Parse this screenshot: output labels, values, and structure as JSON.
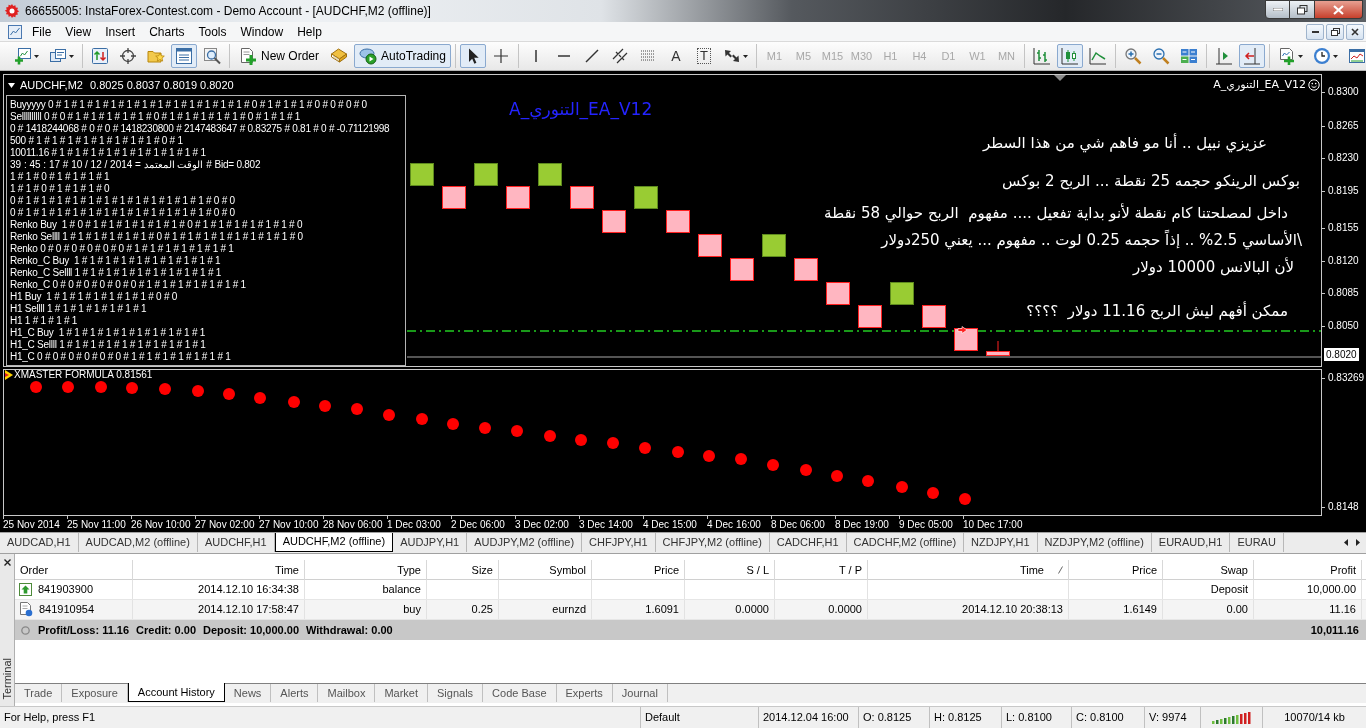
{
  "window": {
    "title": "66655005: InstaForex-Contest.com - Demo Account - [AUDCHF,M2 (offline)]"
  },
  "menu": [
    "File",
    "View",
    "Insert",
    "Charts",
    "Tools",
    "Window",
    "Help"
  ],
  "toolbar": [
    {
      "items": [
        {
          "kind": "icon",
          "pressed": false
        },
        {
          "kind": "icon",
          "pressed": false
        }
      ]
    },
    {
      "items": [
        {
          "kind": "icon",
          "pressed": false
        },
        {
          "kind": "icon",
          "pressed": false
        },
        {
          "kind": "icon",
          "pressed": false
        },
        {
          "kind": "icon",
          "pressed": true
        },
        {
          "kind": "icon",
          "pressed": false
        }
      ]
    },
    {
      "items": [
        {
          "kind": "button",
          "label": "New Order",
          "pressed": false
        },
        {
          "kind": "icon",
          "pressed": false
        },
        {
          "kind": "button",
          "label": "AutoTrading",
          "pressed": true
        }
      ]
    },
    {
      "items": [
        {
          "kind": "icon",
          "pressed": true
        },
        {
          "kind": "icon",
          "pressed": false
        }
      ]
    },
    {
      "items": [
        {
          "kind": "icon",
          "pressed": false
        },
        {
          "kind": "icon",
          "pressed": false
        },
        {
          "kind": "icon",
          "pressed": false
        },
        {
          "kind": "icon",
          "pressed": false
        },
        {
          "kind": "icon",
          "pressed": false
        },
        {
          "kind": "text",
          "label": "A",
          "pressed": false
        },
        {
          "kind": "framed",
          "label": "T",
          "pressed": false
        },
        {
          "kind": "icon",
          "pressed": false
        }
      ]
    },
    {
      "items": [
        {
          "kind": "timeframe",
          "label": "M1",
          "disabled": true
        },
        {
          "kind": "timeframe",
          "label": "M5",
          "disabled": true
        },
        {
          "kind": "timeframe",
          "label": "M15",
          "disabled": true
        },
        {
          "kind": "timeframe",
          "label": "M30",
          "disabled": true
        },
        {
          "kind": "timeframe",
          "label": "H1",
          "disabled": true
        },
        {
          "kind": "timeframe",
          "label": "H4",
          "disabled": true
        },
        {
          "kind": "timeframe",
          "label": "D1",
          "disabled": true
        },
        {
          "kind": "timeframe",
          "label": "W1",
          "disabled": true
        },
        {
          "kind": "timeframe",
          "label": "MN",
          "disabled": true
        }
      ]
    },
    {
      "items": [
        {
          "kind": "icon",
          "pressed": false
        },
        {
          "kind": "icon",
          "pressed": true
        },
        {
          "kind": "icon",
          "pressed": false
        }
      ]
    },
    {
      "items": [
        {
          "kind": "icon",
          "pressed": false
        },
        {
          "kind": "icon",
          "pressed": false
        },
        {
          "kind": "icon",
          "pressed": false
        }
      ]
    },
    {
      "items": [
        {
          "kind": "icon",
          "pressed": false
        },
        {
          "kind": "icon",
          "pressed": true
        }
      ]
    },
    {
      "items": [
        {
          "kind": "icon",
          "pressed": false
        },
        {
          "kind": "icon",
          "pressed": false
        },
        {
          "kind": "icon",
          "pressed": false
        }
      ]
    }
  ],
  "chart": {
    "symbol": "AUDCHF,M2",
    "quotes": "0.8025 0.8037 0.8019 0.8020",
    "expert": "A_التنوري_EA_V12",
    "info_lines": [
      "Buyyyyy 0 # 1 # 1 # 1 # 1 # 1 # 1 # 1 # 1 # 1 # 1 # 1 # 1 # 0 # 1 # 1 # 1 # 0 # 0 # 0 # 0",
      "Sellllllllll 0 # 0 # 1 # 1 # 1 # 1 # 1 # 0 # 1 # 1 # 1 # 1 # 1 # 0 # 1 # 1 # 1",
      "0 # 1418244068 # 0 # 0 # 1418230800 # 2147483647 # 0.83275 # 0.81 # 0 # -0.71121998",
      "500 # 1 # 1 # 1 # 1 # 1 # 1 # 1 # 1 # 0 # 1",
      "10011.16 # 1 # 1 # 1 # 1 # 1 # 1 # 1 # 1 # 1 # 1",
      "39 : 45 : 17 # 10 / 12 / 2014 = الوقت المعتمد # Bid= 0.802",
      "1 # 1 # 0 # 1 # 1 # 1 # 1",
      "1 # 1 # 0 # 1 # 1 # 1 # 0",
      "0 # 1 # 1 # 1 # 1 # 1 # 1 # 1 # 1 # 1 # 1 # 1 # 1 # 0 # 0",
      "0 # 1 # 1 # 1 # 1 # 1 # 1 # 1 # 1 # 1 # 1 # 1 # 1 # 0 # 0",
      "Renko Buy  1 # 0 # 1 # 1 # 1 # 1 # 1 # 1 # 0 # 1 # 1 # 1 # 1 # 1 # 1 # 0",
      "Renko Sellll 1 # 1 # 1 # 1 # 1 # 1 # 0 # 1 # 1 # 1 # 1 # 1 # 1 # 1 # 1 # 0",
      "Renko 0 # 0 # 0 # 0 # 0 # 0 # 1 # 1 # 1 # 1 # 1 # 1 # 1",
      "Renko_C Buy  1 # 1 # 1 # 1 # 1 # 1 # 1 # 1 # 1 # 1",
      "Renko_C Sellll 1 # 1 # 1 # 1 # 1 # 1 # 1 # 1 # 1 # 1",
      "Renko_C 0 # 0 # 0 # 0 # 0 # 0 # 1 # 1 # 1 # 1 # 1 # 1 # 1",
      "H1 Buy  1 # 1 # 1 # 1 # 1 # 1 # 1 # 0 # 0",
      "H1 Sellll 1 # 1 # 1 # 1 # 1 # 1 # 1",
      "H1 1 # 1 # 1 # 1",
      "H1_C Buy  1 # 1 # 1 # 1 # 1 # 1 # 1 # 1 # 1 # 1",
      "H1_C Sellll 1 # 1 # 1 # 1 # 1 # 1 # 1 # 1 # 1 # 1",
      "H1_C 0 # 0 # 0 # 0 # 0 # 0 # 1 # 1 # 1 # 1 # 1 # 1 # 1"
    ],
    "overlay_title": "A_التنوري_EA_V12",
    "comments": [
      "عزيزي نبيل .. أنا مو فاهم شي من هذا السطر",
      "بوكس الرينكو حجمه 25 نقطة ... الربح 2 بوكس",
      "داخل لمصلحتنا كام نقطة لأنو بداية تفعيل .... مفهوم  الربح حوالي 58 نقطة",
      "\\الأساسي 2.5% .. إذاً حجمه 0.25 لوت .. مفهوم ... يعني 250دولار",
      "لأن البالانس 10000 دولار",
      "ممكن أفهم ليش الربح 11.16 دولار  ؟؟؟؟"
    ],
    "price_axis": [
      "0.8300",
      "0.8265",
      "0.8230",
      "0.8195",
      "0.8155",
      "0.8120",
      "0.8085",
      "0.8050"
    ],
    "current_price": "0.8020",
    "indicator": {
      "label": "XMASTER FORMULA 0.81561",
      "axis": [
        "0.83269",
        "0.8148"
      ]
    },
    "time_axis": [
      "25 Nov 2014",
      "25 Nov 11:00",
      "26 Nov 10:00",
      "27 Nov 02:00",
      "27 Nov 10:00",
      "28 Nov 06:00",
      "1 Dec 03:00",
      "2 Dec 06:00",
      "3 Dec 02:00",
      "3 Dec 14:00",
      "4 Dec 15:00",
      "4 Dec 16:00",
      "8 Dec 06:00",
      "8 Dec 19:00",
      "9 Dec 05:00",
      "10 Dec 17:00"
    ]
  },
  "chart_tabs": [
    {
      "label": "AUDCAD,H1",
      "selected": false
    },
    {
      "label": "AUDCAD,M2 (offline)",
      "selected": false
    },
    {
      "label": "AUDCHF,H1",
      "selected": false
    },
    {
      "label": "AUDCHF,M2 (offline)",
      "selected": true
    },
    {
      "label": "AUDJPY,H1",
      "selected": false
    },
    {
      "label": "AUDJPY,M2 (offline)",
      "selected": false
    },
    {
      "label": "CHFJPY,H1",
      "selected": false
    },
    {
      "label": "CHFJPY,M2 (offline)",
      "selected": false
    },
    {
      "label": "CADCHF,H1",
      "selected": false
    },
    {
      "label": "CADCHF,M2 (offline)",
      "selected": false
    },
    {
      "label": "NZDJPY,H1",
      "selected": false
    },
    {
      "label": "NZDJPY,M2 (offline)",
      "selected": false
    },
    {
      "label": "EURAUD,H1",
      "selected": false
    },
    {
      "label": "EURAU",
      "selected": false
    }
  ],
  "terminal": {
    "title": "Terminal",
    "columns": [
      {
        "label": "Order",
        "sorted": false
      },
      {
        "label": "Time",
        "sorted": false
      },
      {
        "label": "Type",
        "sorted": false
      },
      {
        "label": "Size",
        "sorted": false
      },
      {
        "label": "Symbol",
        "sorted": false
      },
      {
        "label": "Price",
        "sorted": false
      },
      {
        "label": "S / L",
        "sorted": false
      },
      {
        "label": "T / P",
        "sorted": false
      },
      {
        "label": "Time",
        "sorted": true
      },
      {
        "label": "Price",
        "sorted": false
      },
      {
        "label": "Swap",
        "sorted": false
      },
      {
        "label": "Profit",
        "sorted": false
      }
    ],
    "rows": [
      {
        "kind": "balance",
        "order": "841903900",
        "open_time": "2014.12.10 16:34:38",
        "type": "balance",
        "comment": "Deposit",
        "profit": "10,000.00"
      },
      {
        "kind": "trade",
        "order": "841910954",
        "open_time": "2014.12.10 17:58:47",
        "type": "buy",
        "size": "0.25",
        "symbol": "eurnzd",
        "open_price": "1.6091",
        "sl": "0.0000",
        "tp": "0.0000",
        "close_time": "2014.12.10 20:38:13",
        "close_price": "1.6149",
        "swap": "0.00",
        "profit": "11.16"
      }
    ],
    "summary": {
      "items": [
        "Profit/Loss: 11.16",
        "Credit: 0.00",
        "Deposit: 10,000.00",
        "Withdrawal: 0.00"
      ],
      "total": "10,011.16"
    },
    "tabs": [
      {
        "label": "Trade",
        "selected": false
      },
      {
        "label": "Exposure",
        "selected": false
      },
      {
        "label": "Account History",
        "selected": true
      },
      {
        "label": "News",
        "selected": false
      },
      {
        "label": "Alerts",
        "selected": false
      },
      {
        "label": "Mailbox",
        "selected": false
      },
      {
        "label": "Market",
        "selected": false
      },
      {
        "label": "Signals",
        "selected": false
      },
      {
        "label": "Code Base",
        "selected": false
      },
      {
        "label": "Experts",
        "selected": false
      },
      {
        "label": "Journal",
        "selected": false
      }
    ]
  },
  "status_bar": [
    "For Help, press F1",
    "Default",
    "2014.12.04 16:00",
    "O: 0.8125",
    "H: 0.8125",
    "L: 0.8100",
    "C: 0.8100",
    "V: 9974",
    "10070/14 kb"
  ]
}
